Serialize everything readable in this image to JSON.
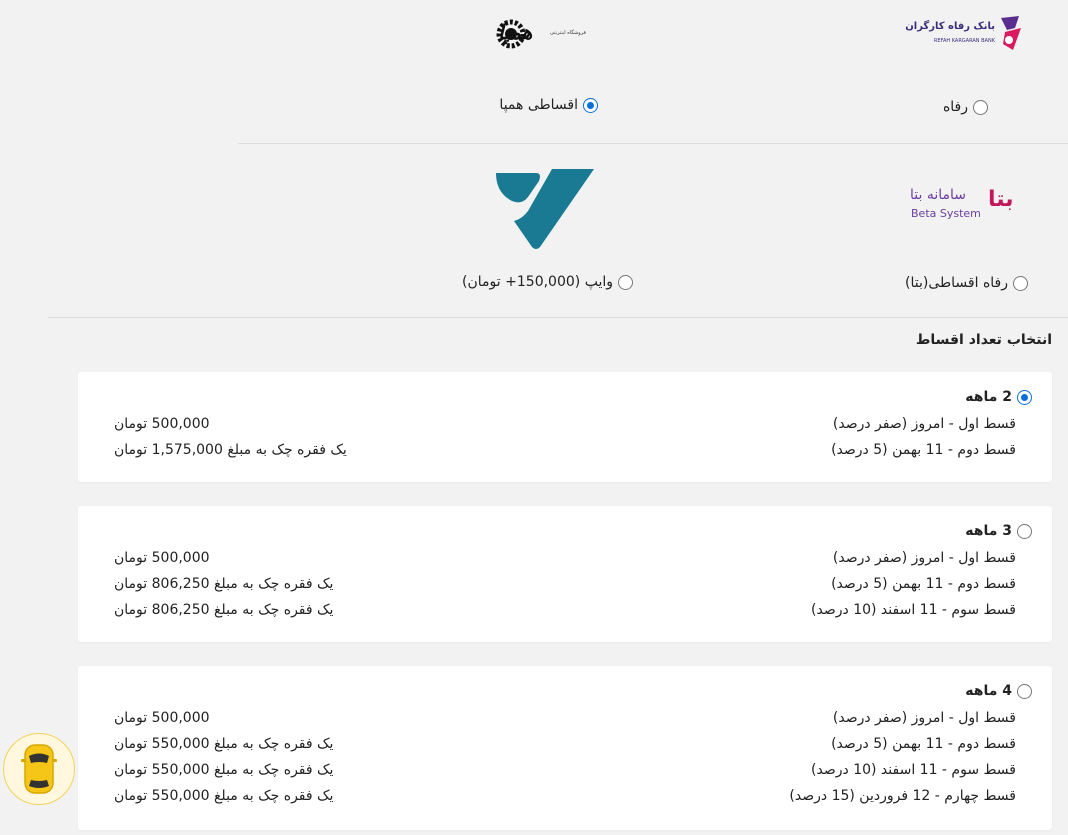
{
  "lenders": {
    "refah_logo": {
      "fa": "بانک رفاه کارگران",
      "en": "REFAH KARGARAN BANK"
    },
    "hampa_logo": {
      "brand": "همپا",
      "sub": "فروشگاه اینترنتی"
    },
    "beta_logo": {
      "fa": "سامانه بتا",
      "en": "Beta System",
      "mark": "بتا"
    },
    "options": [
      {
        "label": "رفاه",
        "selected": false
      },
      {
        "label": "اقساطی همپا",
        "selected": true
      },
      {
        "label": "رفاه اقساطی(بتا)",
        "selected": false
      },
      {
        "label": "وایپ (150,000+ تومان)",
        "selected": false
      }
    ]
  },
  "installments": {
    "title": "انتخاب تعداد اقساط",
    "plans": [
      {
        "name": "2 ماهه",
        "selected": true,
        "rows": [
          {
            "label": "قسط اول - امروز (صفر درصد)",
            "amount": "500,000 تومان"
          },
          {
            "label": "قسط دوم - 11 بهمن (5 درصد)",
            "amount": "یک فقره چک به مبلغ 1,575,000 تومان"
          }
        ]
      },
      {
        "name": "3 ماهه",
        "selected": false,
        "rows": [
          {
            "label": "قسط اول - امروز (صفر درصد)",
            "amount": "500,000 تومان"
          },
          {
            "label": "قسط دوم - 11 بهمن (5 درصد)",
            "amount": "یک فقره چک به مبلغ 806,250 تومان"
          },
          {
            "label": "قسط سوم - 11 اسفند (10 درصد)",
            "amount": "یک فقره چک به مبلغ 806,250 تومان"
          }
        ]
      },
      {
        "name": "4 ماهه",
        "selected": false,
        "rows": [
          {
            "label": "قسط اول - امروز (صفر درصد)",
            "amount": "500,000 تومان"
          },
          {
            "label": "قسط دوم - 11 بهمن (5 درصد)",
            "amount": "یک فقره چک به مبلغ 550,000 تومان"
          },
          {
            "label": "قسط سوم - 11 اسفند (10 درصد)",
            "amount": "یک فقره چک به مبلغ 550,000 تومان"
          },
          {
            "label": "قسط چهارم - 12 فروردین (15 درصد)",
            "amount": "یک فقره چک به مبلغ 550,000 تومان"
          }
        ]
      }
    ]
  },
  "colors": {
    "accent": "#0b6fd6",
    "refah_purple": "#5b2d8e",
    "wipe_teal": "#1a7a93",
    "beta_pink": "#c2185b",
    "car_yellow": "#f5c518"
  },
  "floating": {
    "icon": "car-icon"
  }
}
